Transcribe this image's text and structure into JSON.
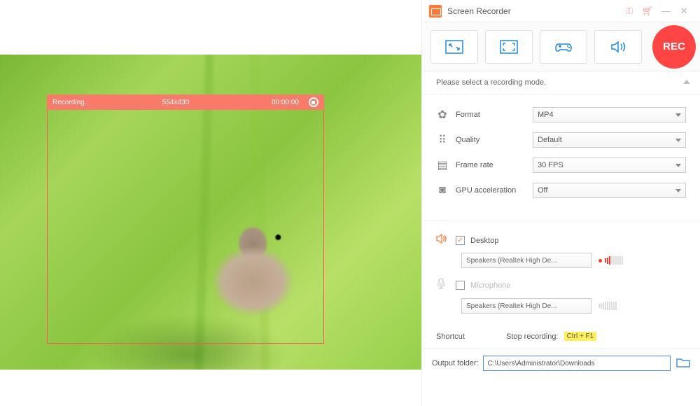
{
  "title": "Screen Recorder",
  "overlay": {
    "status": "Recording...",
    "dim": "554x430",
    "time": "00:00:00"
  },
  "hint": "Please select a recording mode.",
  "rec": "REC",
  "settings": {
    "format": {
      "label": "Format",
      "value": "MP4"
    },
    "quality": {
      "label": "Quality",
      "value": "Default"
    },
    "framerate": {
      "label": "Frame rate",
      "value": "30 FPS"
    },
    "gpu": {
      "label": "GPU acceleration",
      "value": "Off"
    }
  },
  "audio": {
    "desktop": {
      "label": "Desktop",
      "device": "Speakers (Realtek High De...",
      "checked": true
    },
    "mic": {
      "label": "Microphone",
      "device": "Speakers (Realtek High De...",
      "checked": false
    }
  },
  "shortcut": {
    "label": "Shortcut",
    "stop": "Stop recording:",
    "key": "Ctrl + F1"
  },
  "output": {
    "label": "Output folder:",
    "path": "C:\\Users\\Administrator\\Downloads"
  }
}
